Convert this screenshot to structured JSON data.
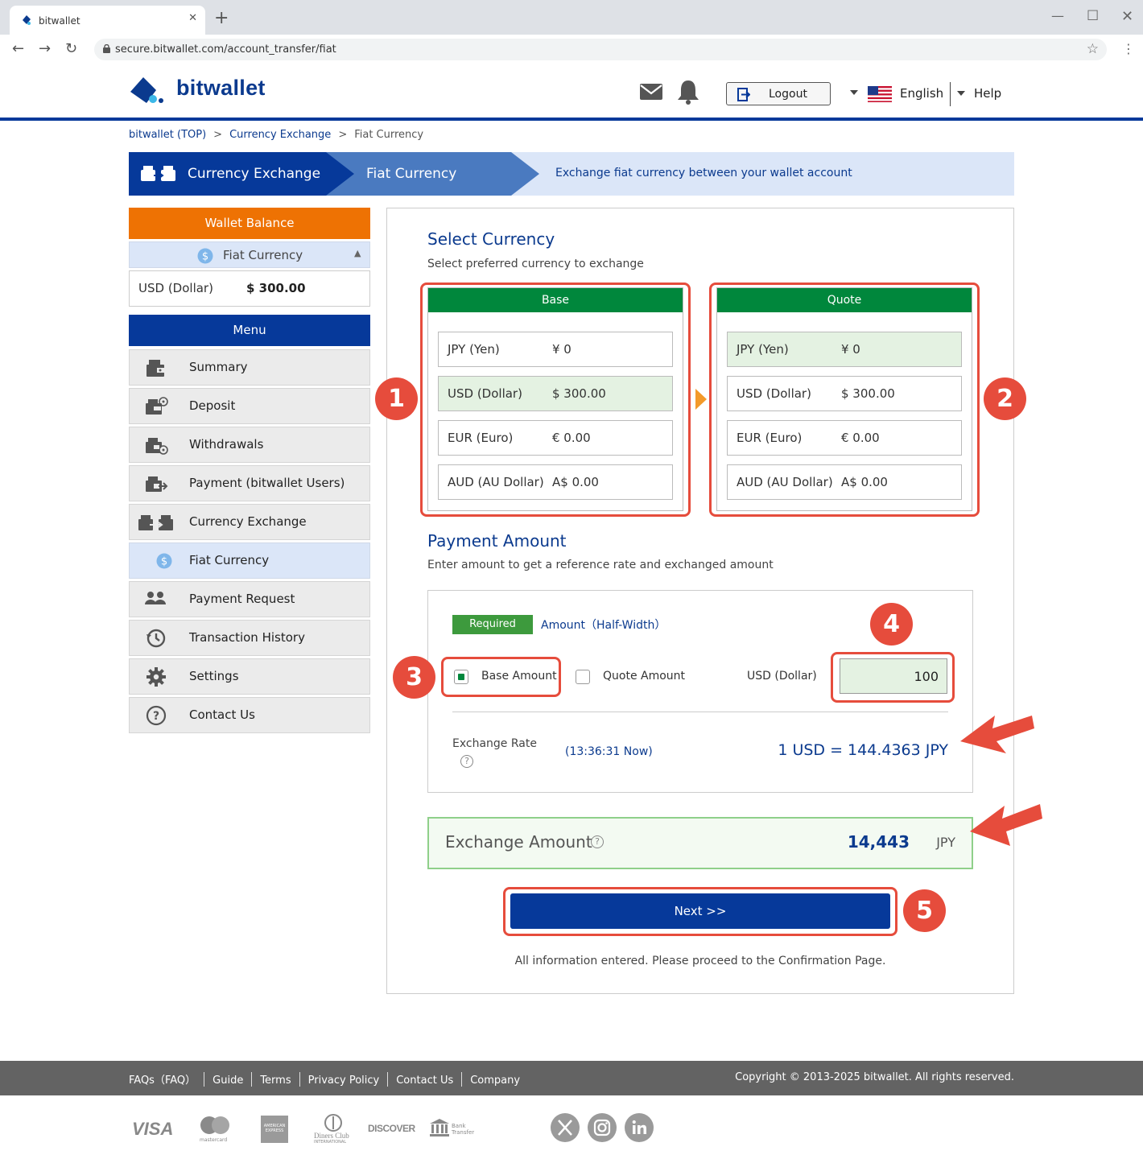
{
  "browser": {
    "tab_title": "bitwallet",
    "url": "secure.bitwallet.com/account_transfer/fiat"
  },
  "header": {
    "logo_text": "bitwallet",
    "logout_label": "Logout",
    "language": "English",
    "help": "Help"
  },
  "breadcrumb": [
    "bitwallet (TOP)",
    "Currency Exchange",
    "Fiat Currency"
  ],
  "banner": {
    "step1": "Currency Exchange",
    "step2": "Fiat Currency",
    "description": "Exchange fiat currency between your wallet account"
  },
  "sidebar": {
    "wallet_balance_title": "Wallet Balance",
    "fiat_currency_label": "Fiat Currency",
    "balance_currency": "USD (Dollar)",
    "balance_amount": "$ 300.00",
    "menu_title": "Menu",
    "items": [
      {
        "label": "Summary",
        "icon": "wallet-icon"
      },
      {
        "label": "Deposit",
        "icon": "deposit-icon"
      },
      {
        "label": "Withdrawals",
        "icon": "withdrawal-icon"
      },
      {
        "label": "Payment (bitwallet Users)",
        "icon": "payment-icon"
      },
      {
        "label": "Currency Exchange",
        "icon": "exchange-icon"
      },
      {
        "label": "Fiat Currency",
        "icon": "dollar-coin-icon",
        "active": true
      },
      {
        "label": "Payment Request",
        "icon": "users-icon"
      },
      {
        "label": "Transaction History",
        "icon": "history-icon"
      },
      {
        "label": "Settings",
        "icon": "gear-icon"
      },
      {
        "label": "Contact Us",
        "icon": "question-icon"
      }
    ]
  },
  "select_currency": {
    "title": "Select Currency",
    "subtitle": "Select preferred currency to exchange",
    "base": {
      "header": "Base",
      "options": [
        {
          "currency": "JPY (Yen)",
          "amount": "¥ 0"
        },
        {
          "currency": "USD (Dollar)",
          "amount": "$ 300.00"
        },
        {
          "currency": "EUR (Euro)",
          "amount": "€ 0.00"
        },
        {
          "currency": "AUD (AU Dollar)",
          "amount": "A$ 0.00"
        }
      ],
      "selected_index": 1
    },
    "quote": {
      "header": "Quote",
      "options": [
        {
          "currency": "JPY (Yen)",
          "amount": "¥ 0"
        },
        {
          "currency": "USD (Dollar)",
          "amount": "$ 300.00"
        },
        {
          "currency": "EUR (Euro)",
          "amount": "€ 0.00"
        },
        {
          "currency": "AUD (AU Dollar)",
          "amount": "A$ 0.00"
        }
      ],
      "selected_index": 0
    }
  },
  "payment_amount": {
    "title": "Payment Amount",
    "subtitle": "Enter amount to get a reference rate and exchanged amount",
    "required_badge": "Required",
    "amount_label": "Amount（Half-Width）",
    "base_amount_label": "Base Amount",
    "quote_amount_label": "Quote Amount",
    "base_amount_checked": true,
    "quote_amount_checked": false,
    "unit_label": "USD (Dollar)",
    "amount_value": "100",
    "exchange_rate_label": "Exchange Rate",
    "rate_time": "(13:36:31 Now)",
    "rate_value": "1 USD = 144.4363 JPY"
  },
  "exchange_amount": {
    "label": "Exchange Amount",
    "value": "14,443",
    "currency": "JPY"
  },
  "next_button": "Next >>",
  "note": "All information entered. Please proceed to the Confirmation Page.",
  "badges": [
    "1",
    "2",
    "3",
    "4",
    "5"
  ],
  "footer": {
    "links": [
      "FAQs（FAQ）",
      "Guide",
      "Terms",
      "Privacy Policy",
      "Contact Us",
      "Company"
    ],
    "copyright": "Copyright © 2013-2025 bitwallet. All rights reserved."
  },
  "payment_logos": {
    "visa": "VISA",
    "mastercard": "mastercard",
    "amex": "AMERICAN EXPRESS",
    "diners": "Diners Club",
    "diners_sub": "INTERNATIONAL",
    "discover": "DISCOVER",
    "bank": "Bank",
    "bank_sub": "Transfer"
  },
  "colors": {
    "brand_blue": "#06399a",
    "orange": "#ee7203",
    "green": "#00873c",
    "annotation_red": "#e64c3c"
  }
}
